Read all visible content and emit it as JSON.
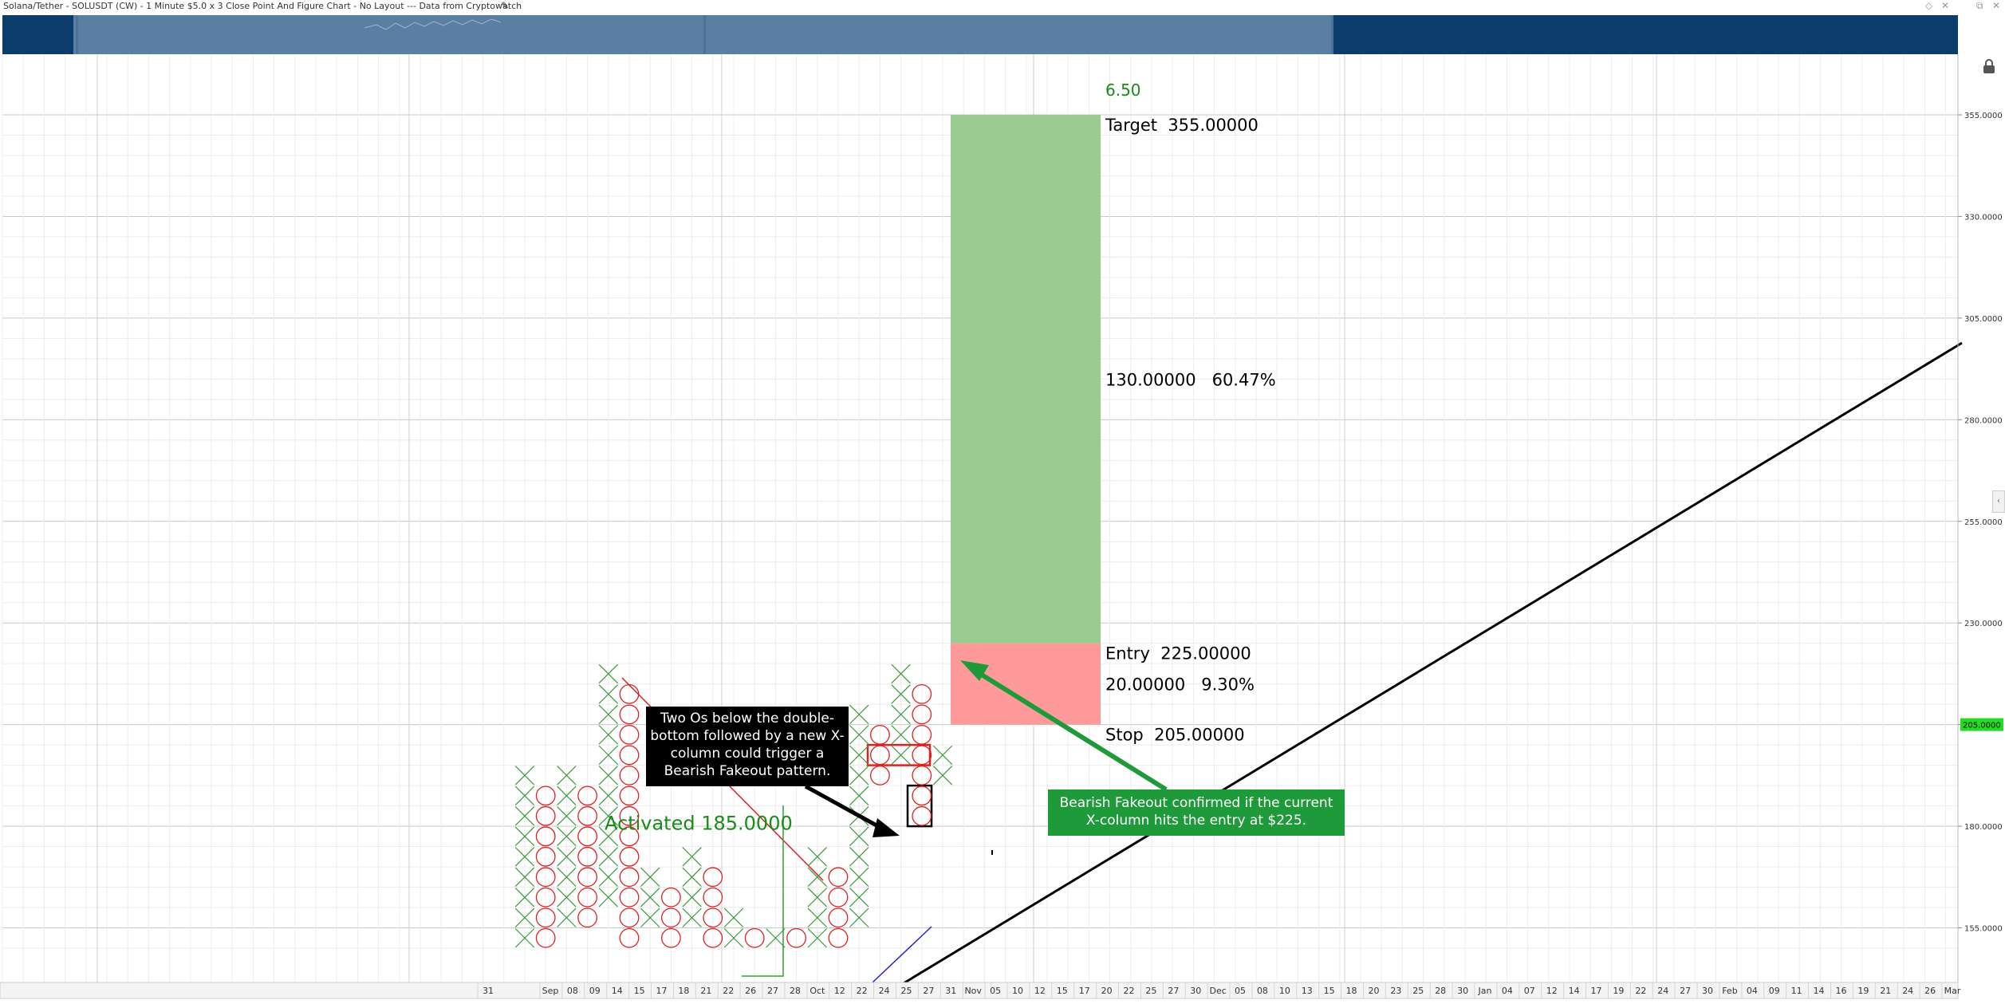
{
  "window": {
    "title": "Solana/Tether - SOLUSDT (CW) - 1 Minute $5.0 x 3 Close Point And Figure Chart - No Layout --- Data from Cryptowatch",
    "edit_icon": "pencil-icon",
    "controls": [
      "◇",
      "✕",
      "⧉",
      "✕"
    ]
  },
  "colors": {
    "x_mark": "#3a9a3a",
    "o_mark": "#e02020",
    "target_zone": "#9acc92",
    "stop_zone": "#ff9a9a",
    "annotation_green": "#1f9a3a",
    "callout_black": "#000000",
    "navigator": "#0c3c6c",
    "navigator_window": "#5a7fa3",
    "price_tag": "#22dd22"
  },
  "chart_data": {
    "type": "point-and-figure",
    "box_size": 5,
    "reversal": 3,
    "y_axis": {
      "ticks": [
        "355.0000",
        "330.0000",
        "305.0000",
        "280.0000",
        "255.0000",
        "230.0000",
        "205.0000",
        "180.0000",
        "155.0000"
      ],
      "current_price_label": "205.0000",
      "current_price": 205
    },
    "x_axis": {
      "labels": [
        "31",
        "Sep",
        "08",
        "09",
        "14",
        "15",
        "17",
        "18",
        "21",
        "22",
        "26",
        "27",
        "28",
        "Oct",
        "12",
        "22",
        "24",
        "25",
        "27",
        "31",
        "Nov",
        "05",
        "10",
        "12",
        "15",
        "17",
        "20",
        "22",
        "25",
        "27",
        "30",
        "Dec",
        "05",
        "08",
        "10",
        "13",
        "15",
        "18",
        "20",
        "23",
        "25",
        "28",
        "30",
        "Jan",
        "04",
        "07",
        "12",
        "14",
        "17",
        "19",
        "22",
        "24",
        "27",
        "30",
        "Feb",
        "04",
        "09",
        "11",
        "14",
        "16",
        "19",
        "21",
        "24",
        "26",
        "Mar"
      ]
    },
    "columns": [
      {
        "col": 0,
        "type": "X",
        "low": 150,
        "high": 195
      },
      {
        "col": 1,
        "type": "O",
        "low": 150,
        "high": 190
      },
      {
        "col": 2,
        "type": "X",
        "low": 155,
        "high": 195
      },
      {
        "col": 3,
        "type": "O",
        "low": 155,
        "high": 190
      },
      {
        "col": 4,
        "type": "X",
        "low": 160,
        "high": 220
      },
      {
        "col": 5,
        "type": "O",
        "low": 150,
        "high": 215
      },
      {
        "col": 6,
        "type": "X",
        "low": 155,
        "high": 170
      },
      {
        "col": 7,
        "type": "O",
        "low": 150,
        "high": 165
      },
      {
        "col": 8,
        "type": "X",
        "low": 155,
        "high": 175
      },
      {
        "col": 9,
        "type": "O",
        "low": 150,
        "high": 170
      },
      {
        "col": 10,
        "type": "X",
        "low": 150,
        "high": 160
      },
      {
        "col": 11,
        "type": "O",
        "low": 150,
        "high": 155
      },
      {
        "col": 12,
        "type": "X",
        "low": 150,
        "high": 155
      },
      {
        "col": 13,
        "type": "O",
        "low": 150,
        "high": 155
      },
      {
        "col": 14,
        "type": "X",
        "low": 150,
        "high": 175
      },
      {
        "col": 15,
        "type": "O",
        "low": 150,
        "high": 170
      },
      {
        "col": 16,
        "type": "X",
        "low": 155,
        "high": 210
      },
      {
        "col": 17,
        "type": "O",
        "low": 190,
        "high": 205
      },
      {
        "col": 18,
        "type": "X",
        "low": 195,
        "high": 220
      },
      {
        "col": 19,
        "type": "O",
        "low": 180,
        "high": 215
      },
      {
        "col": 20,
        "type": "X",
        "low": 190,
        "high": 200
      }
    ],
    "trade": {
      "target": 355,
      "entry": 225,
      "stop": 205,
      "activated": 185,
      "ratio_label": "6.50",
      "target_label": "Target  355.00000",
      "reward_label": "130.00000   60.47%",
      "entry_label": "Entry  225.00000",
      "risk_label": "20.00000   9.30%",
      "stop_label": "Stop  205.00000",
      "activated_label": "Activated 185.0000"
    },
    "annotations": [
      {
        "id": "black-callout",
        "text_lines": [
          "Two Os below the double-",
          "bottom followed by a new X-",
          "column could trigger a",
          "Bearish Fakeout pattern."
        ]
      },
      {
        "id": "green-callout",
        "text_lines": [
          "Bearish Fakeout confirmed if the current",
          "X-column hits the entry at $225."
        ]
      }
    ],
    "trendline": {
      "color": "#000000"
    },
    "grid": true
  }
}
